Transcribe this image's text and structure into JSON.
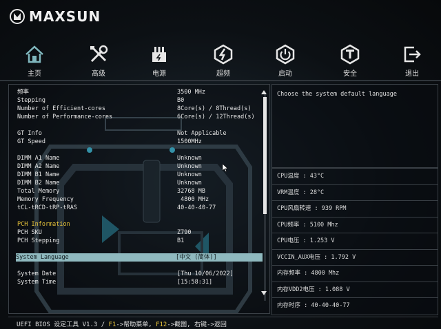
{
  "header": {
    "brand": "MAXSUN"
  },
  "nav": [
    {
      "label": "主页",
      "icon": "home-icon"
    },
    {
      "label": "高级",
      "icon": "tools-icon"
    },
    {
      "label": "电源",
      "icon": "power-supply-icon"
    },
    {
      "label": "超频",
      "icon": "overclock-icon"
    },
    {
      "label": "启动",
      "icon": "boot-power-icon"
    },
    {
      "label": "安全",
      "icon": "security-icon"
    },
    {
      "label": "退出",
      "icon": "exit-icon"
    }
  ],
  "settings": {
    "freq": {
      "label": "频率",
      "value": "3500 MHz"
    },
    "stepping": {
      "label": "Stepping",
      "value": "B0"
    },
    "e_cores": {
      "label": "Number of Efficient-cores",
      "value": "8Core(s) / 8Thread(s)"
    },
    "p_cores": {
      "label": "Number of Performance-cores",
      "value": "6Core(s) / 12Thread(s)"
    },
    "gt_info": {
      "label": "GT Info",
      "value": "Not Applicable"
    },
    "gt_speed": {
      "label": "GT Speed",
      "value": "1500MHz"
    },
    "dimm_a1": {
      "label": "DIMM A1 Name",
      "value": "Unknown"
    },
    "dimm_a2": {
      "label": "DIMM A2 Name",
      "value": "Unknown"
    },
    "dimm_b1": {
      "label": "DIMM B1 Name",
      "value": "Unknown"
    },
    "dimm_b2": {
      "label": "DIMM B2 Name",
      "value": "Unknown"
    },
    "total_mem": {
      "label": "Total Memory",
      "value": "32768 MB"
    },
    "mem_freq": {
      "label": "Memory Frequency",
      "value": " 4800 MHz"
    },
    "timings": {
      "label": "tCL-tRCD-tRP-tRAS",
      "value": "40-40-40-77"
    },
    "pch_info": {
      "label": "PCH Information"
    },
    "pch_sku": {
      "label": "PCH SKU",
      "value": "Z790"
    },
    "pch_stepping": {
      "label": "PCH Stepping",
      "value": "B1"
    },
    "language": {
      "label": "System Language",
      "value": "[中文 (简体)]"
    },
    "date": {
      "label": "System Date",
      "value": "[Thu 10/06/2022]"
    },
    "time": {
      "label": "System Time",
      "value": "[15:58:31]"
    }
  },
  "help": {
    "text": "Choose the system default language"
  },
  "status": [
    "CPU温度 : 43°C",
    "VRM温度 : 28°C",
    "CPU风扇转速 : 939 RPM",
    "CPU频率 : 5100 Mhz",
    "CPU电压 : 1.253 V",
    "VCCIN_AUX电压 : 1.792 V",
    "内存频率 : 4800 Mhz",
    "内存VDD2电压 : 1.088 V",
    "内存时序 : 40-40-40-77"
  ],
  "footer": {
    "prefix": "UEFI BIOS 设定工具 V1.3 / ",
    "f1_key": "F1",
    "f1_text": "->帮助菜单, ",
    "f12_key": "F12",
    "f12_text": "->截图, 右键->返回"
  },
  "colors": {
    "accent": "#e8c43a",
    "highlight": "#8fb9bf",
    "text": "#e6e6e6"
  }
}
